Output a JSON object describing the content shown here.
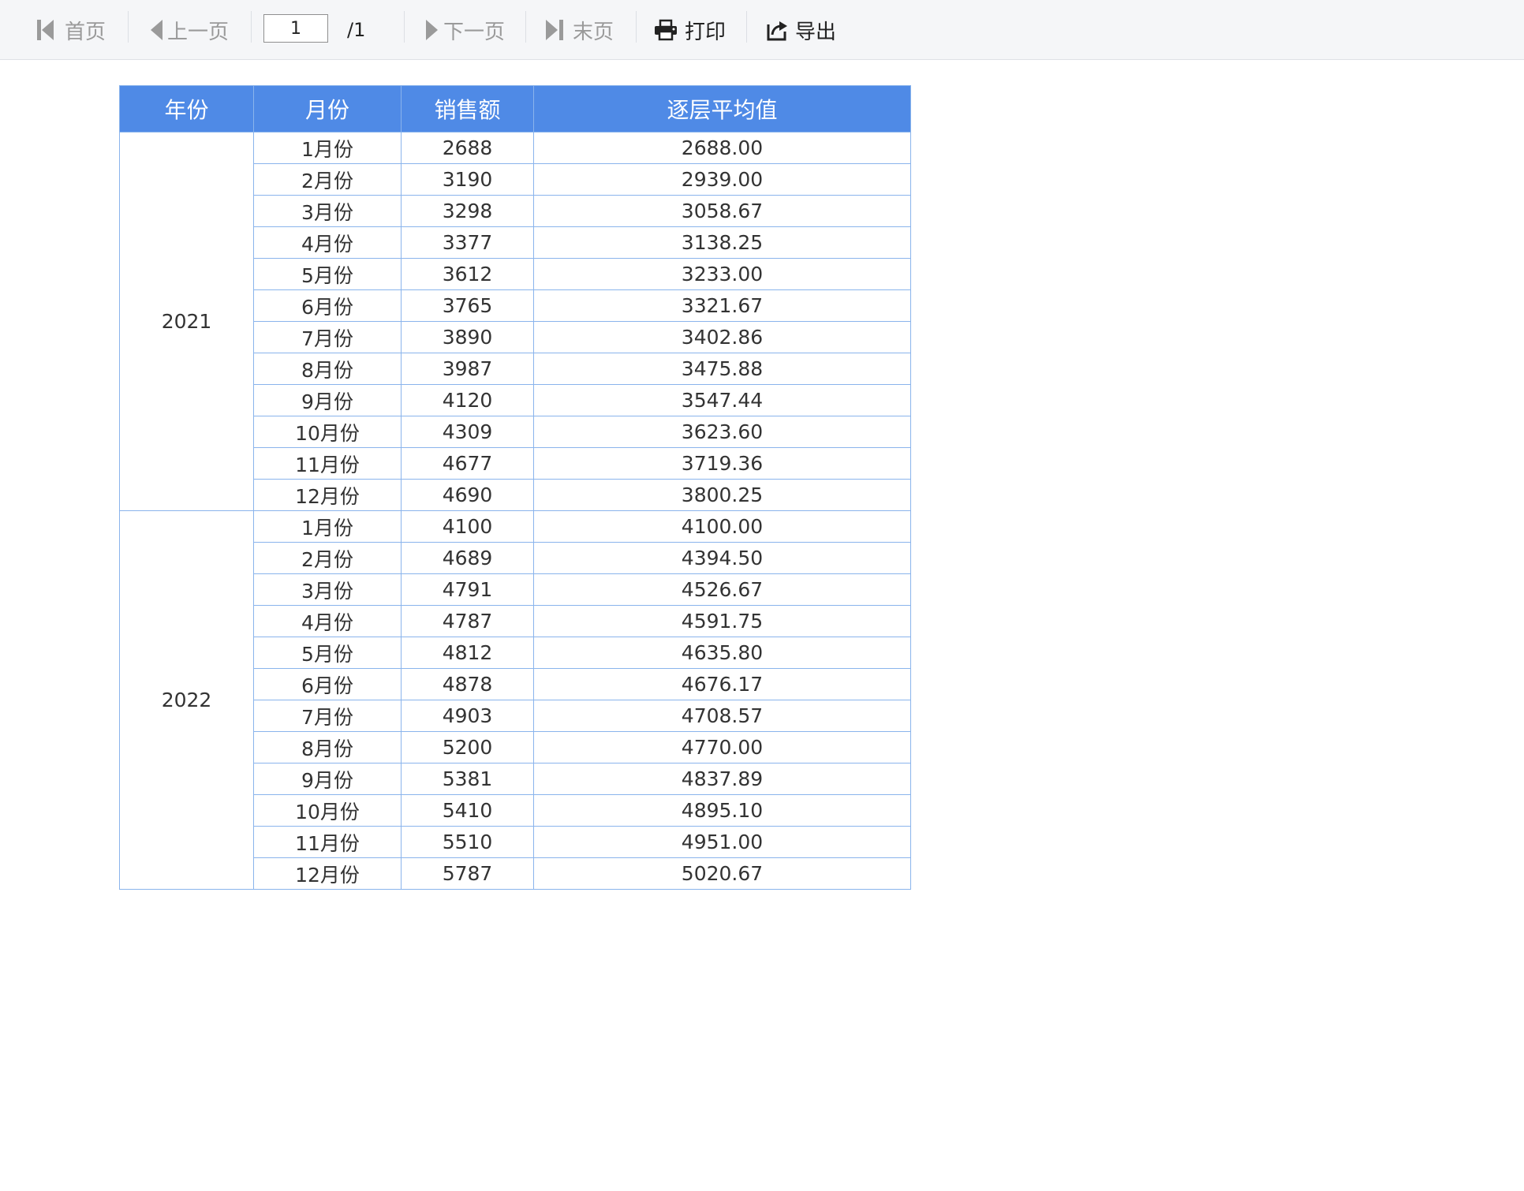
{
  "toolbar": {
    "first_label": "首页",
    "prev_label": "上一页",
    "page_value": "1",
    "page_total": "/1",
    "next_label": "下一页",
    "last_label": "末页",
    "print_label": "打印",
    "export_label": "导出"
  },
  "table": {
    "headers": [
      "年份",
      "月份",
      "销售额",
      "逐层平均值"
    ],
    "groups": [
      {
        "year": "2021",
        "rows": [
          {
            "month": "1月份",
            "sales": "2688",
            "avg": "2688.00"
          },
          {
            "month": "2月份",
            "sales": "3190",
            "avg": "2939.00"
          },
          {
            "month": "3月份",
            "sales": "3298",
            "avg": "3058.67"
          },
          {
            "month": "4月份",
            "sales": "3377",
            "avg": "3138.25"
          },
          {
            "month": "5月份",
            "sales": "3612",
            "avg": "3233.00"
          },
          {
            "month": "6月份",
            "sales": "3765",
            "avg": "3321.67"
          },
          {
            "month": "7月份",
            "sales": "3890",
            "avg": "3402.86"
          },
          {
            "month": "8月份",
            "sales": "3987",
            "avg": "3475.88"
          },
          {
            "month": "9月份",
            "sales": "4120",
            "avg": "3547.44"
          },
          {
            "month": "10月份",
            "sales": "4309",
            "avg": "3623.60"
          },
          {
            "month": "11月份",
            "sales": "4677",
            "avg": "3719.36"
          },
          {
            "month": "12月份",
            "sales": "4690",
            "avg": "3800.25"
          }
        ]
      },
      {
        "year": "2022",
        "rows": [
          {
            "month": "1月份",
            "sales": "4100",
            "avg": "4100.00"
          },
          {
            "month": "2月份",
            "sales": "4689",
            "avg": "4394.50"
          },
          {
            "month": "3月份",
            "sales": "4791",
            "avg": "4526.67"
          },
          {
            "month": "4月份",
            "sales": "4787",
            "avg": "4591.75"
          },
          {
            "month": "5月份",
            "sales": "4812",
            "avg": "4635.80"
          },
          {
            "month": "6月份",
            "sales": "4878",
            "avg": "4676.17"
          },
          {
            "month": "7月份",
            "sales": "4903",
            "avg": "4708.57"
          },
          {
            "month": "8月份",
            "sales": "5200",
            "avg": "4770.00"
          },
          {
            "month": "9月份",
            "sales": "5381",
            "avg": "4837.89"
          },
          {
            "month": "10月份",
            "sales": "5410",
            "avg": "4895.10"
          },
          {
            "month": "11月份",
            "sales": "5510",
            "avg": "4951.00"
          },
          {
            "month": "12月份",
            "sales": "5787",
            "avg": "5020.67"
          }
        ]
      }
    ]
  },
  "colors": {
    "header_bg": "#4f8ae6",
    "border": "#8ab4ec",
    "toolbar_bg": "#f5f6f8",
    "disabled_text": "#9a9a9a"
  },
  "icons": {
    "first": "first-page-icon",
    "prev": "prev-page-icon",
    "next": "next-page-icon",
    "last": "last-page-icon",
    "print": "printer-icon",
    "export": "export-icon"
  }
}
